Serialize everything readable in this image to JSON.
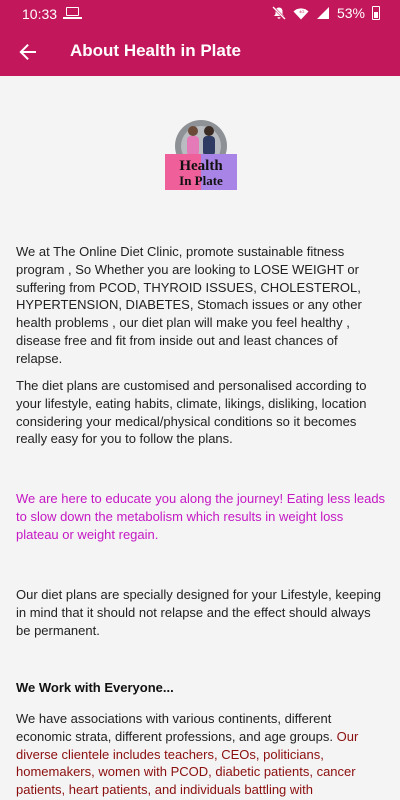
{
  "status_bar": {
    "time": "10:33",
    "battery": "53%"
  },
  "app_bar": {
    "title": "About Health in Plate"
  },
  "logo": {
    "line1": "Health",
    "line2": "In Plate"
  },
  "content": {
    "paragraph1": "We at The Online Diet Clinic, promote sustainable fitness program , So Whether you are looking to LOSE WEIGHT or suffering from PCOD, THYROID ISSUES, CHOLESTEROL, HYPERTENSION, DIABETES, Stomach issues or any other health problems , our diet plan will make you feel healthy , disease free and fit from inside out and least chances of relapse.",
    "paragraph2": "The diet plans are customised and personalised according to your lifestyle, eating habits, climate, likings, disliking, location considering your medical/physical conditions so it becomes really easy for you to follow the plans.",
    "paragraph3": "We are here to educate you along the journey! Eating less leads to slow down the metabolism which results in weight loss plateau or weight regain.",
    "paragraph4": "Our diet plans are specially designed for your Lifestyle, keeping in mind that it should not relapse and the effect should always be permanent.",
    "heading": "We Work with Everyone...",
    "paragraph5_start": "We have associations with various continents, different economic strata, different professions, and age groups. ",
    "paragraph5_highlight": "Our diverse clientele includes teachers, CEOs, politicians, homemakers, women with PCOD, diabetic patients, cancer patients, heart patients, and individuals battling with"
  },
  "colors": {
    "brand": "#c2185b",
    "highlight_text": "#c418c4",
    "red_text": "#8b0e0e"
  }
}
